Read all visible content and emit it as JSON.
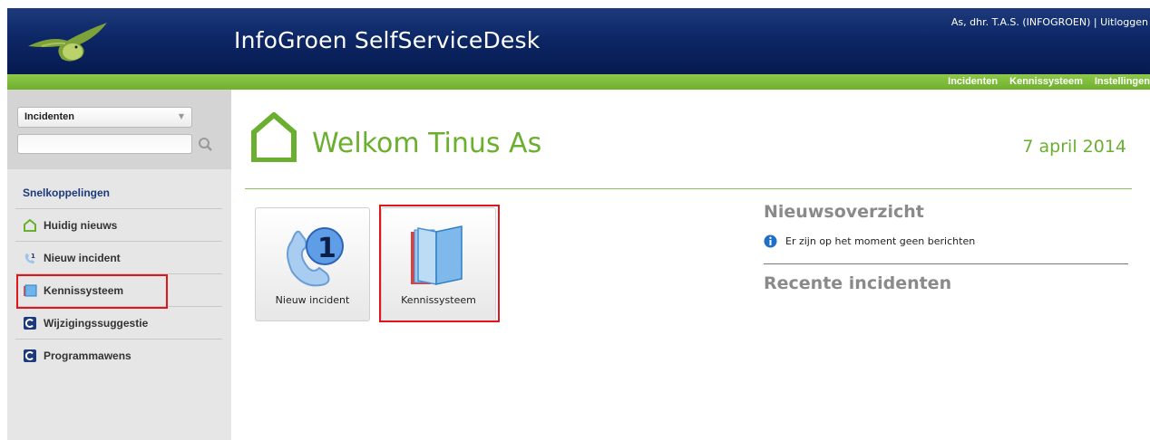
{
  "header": {
    "app_title": "InfoGroen SelfServiceDesk",
    "user_name": "As, dhr. T.A.S. (INFOGROEN)",
    "separator": "|",
    "logout_label": "Uitloggen"
  },
  "nav": {
    "items": [
      "Incidenten",
      "Kennissysteem",
      "Instellingen"
    ]
  },
  "sidebar": {
    "search_select_value": "Incidenten",
    "search_input_value": "",
    "quicklinks_title": "Snelkoppelingen",
    "items": [
      {
        "label": "Huidig nieuws",
        "icon": "house-icon"
      },
      {
        "label": "Nieuw incident",
        "icon": "phone-icon"
      },
      {
        "label": "Kennissysteem",
        "icon": "book-icon"
      },
      {
        "label": "Wijzigingssuggestie",
        "icon": "change-icon"
      },
      {
        "label": "Programmawens",
        "icon": "change-icon"
      }
    ]
  },
  "main": {
    "welcome_title": "Welkom Tinus As",
    "date": "7 april 2014",
    "tiles": [
      {
        "label": "Nieuw incident",
        "icon": "phone-icon"
      },
      {
        "label": "Kennissysteem",
        "icon": "book-icon"
      }
    ],
    "news_title": "Nieuwsoverzicht",
    "news_message": "Er zijn op het moment geen berichten",
    "recent_title": "Recente incidenten"
  },
  "colors": {
    "header_blue": "#0d2766",
    "nav_green": "#6fb02e",
    "accent_green": "#6ab02e",
    "highlight_red": "#e0161b"
  }
}
